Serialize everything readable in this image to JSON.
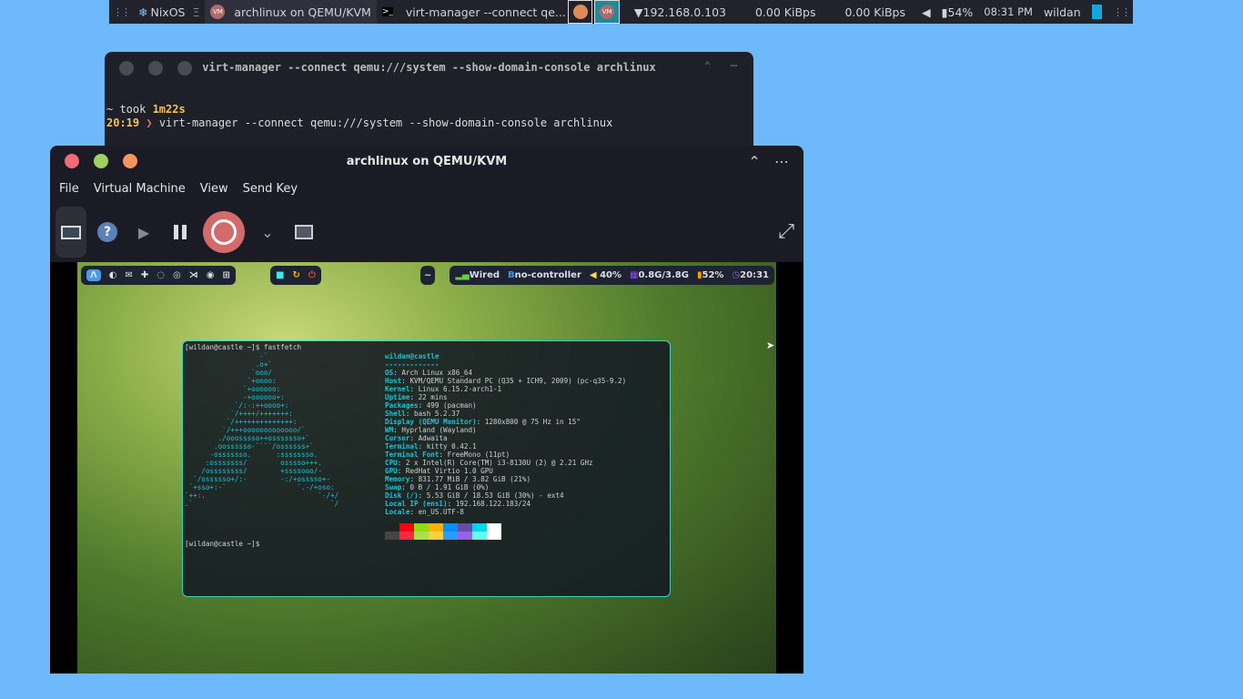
{
  "topbar": {
    "workspace": "NixOS",
    "tabs": [
      {
        "label": "archlinux on QEMU/KVM",
        "icon": "vm-icon"
      },
      {
        "label": "virt-manager --connect qe...",
        "icon": "terminal-icon"
      }
    ],
    "ip": "192.168.0.103",
    "down": "0.00 KiBps",
    "up": "0.00 KiBps",
    "battery": "54%",
    "time": "08:31 PM",
    "user": "wildan"
  },
  "terminal_window": {
    "title": "virt-manager --connect qemu:///system --show-domain-console archlinux",
    "line1_prefix": "~ took ",
    "line1_duration": "1m22s",
    "prompt_time": "20:19",
    "prompt_symbol": "❯",
    "command": "virt-manager --connect qemu:///system --show-domain-console archlinux"
  },
  "vm_window": {
    "title": "archlinux on QEMU/KVM",
    "menu": [
      "File",
      "Virtual Machine",
      "View",
      "Send Key"
    ]
  },
  "guest": {
    "bar": {
      "network": "Wired",
      "bluetooth": "no-controller",
      "volume": "40%",
      "memory": "0.8G/3.8G",
      "battery": "52%",
      "clock": "20:31",
      "center": "~"
    },
    "fastfetch": {
      "prompt": "[wildan@castle ~]$ ",
      "command": "fastfetch",
      "logo": [
        "                  -`",
        "                 .o+`",
        "                `ooo/",
        "               `+oooo:",
        "              `+oooooo:",
        "              -+oooooo+:",
        "            `/:-:++oooo+:",
        "           `/++++/+++++++:",
        "          `/++++++++++++++:",
        "         `/+++ooooooooooooo/`",
        "        ./ooosssso++osssssso+`",
        "       .oossssso-````/ossssss+`",
        "      -osssssso.      :ssssssso.",
        "     :osssssss/        osssso+++.",
        "    /ossssssss/        +ssssooo/-",
        "  `/ossssso+/:-        -:/+osssso+-",
        " `+sso+:-`                 `.-/+oso:",
        "`++:.                           `-/+/",
        ".`                                 `/"
      ],
      "user": "wildan@castle",
      "sep": "-------------",
      "info": [
        [
          "OS",
          "Arch Linux x86_64"
        ],
        [
          "Host",
          "KVM/QEMU Standard PC (Q35 + ICH9, 2009) (pc-q35-9.2)"
        ],
        [
          "Kernel",
          "Linux 6.15.2-arch1-1"
        ],
        [
          "Uptime",
          "22 mins"
        ],
        [
          "Packages",
          "499 (pacman)"
        ],
        [
          "Shell",
          "bash 5.2.37"
        ],
        [
          "Display (QEMU Monitor)",
          "1280x800 @ 75 Hz in 15\""
        ],
        [
          "WM",
          "Hyprland (Wayland)"
        ],
        [
          "Cursor",
          "Adwaita"
        ],
        [
          "Terminal",
          "kitty 0.42.1"
        ],
        [
          "Terminal Font",
          "FreeMono (11pt)"
        ],
        [
          "CPU",
          "2 x Intel(R) Core(TM) i3-8130U (2) @ 2.21 GHz"
        ],
        [
          "GPU",
          "RedHat Virtio 1.0 GPU"
        ],
        [
          "Memory",
          "831.77 MiB / 3.82 GiB (21%)"
        ],
        [
          "Swap",
          "0 B / 1.91 GiB (0%)"
        ],
        [
          "Disk (/)",
          "5.53 GiB / 18.53 GiB (30%) - ext4"
        ],
        [
          "Local IP (ens1)",
          "192.168.122.183/24"
        ],
        [
          "Locale",
          "en_US.UTF-8"
        ]
      ],
      "palette": [
        "#222222",
        "#ff0015",
        "#8fdb10",
        "#ffb300",
        "#0a8cff",
        "#6a4aa8",
        "#00d4e8",
        "#ffffff",
        "#444444",
        "#ff2a40",
        "#a8e050",
        "#ffd23c",
        "#2a9cff",
        "#9a60e8",
        "#60fff0",
        "#ffffff"
      ]
    }
  },
  "colors": {
    "desktop": "#6db9fb",
    "accent": "#3fd1b8",
    "power": "#d46a6a"
  }
}
